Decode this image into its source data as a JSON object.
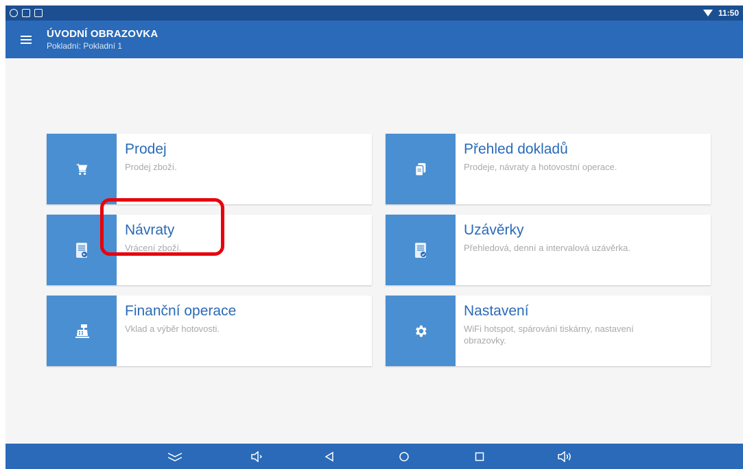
{
  "status_bar": {
    "time": "11:50",
    "left_icons": [
      "teamviewer-icon",
      "screen-icon",
      "sim-icon"
    ],
    "wifi_icon": "wifi-icon"
  },
  "app_bar": {
    "menu_icon": "hamburger-menu-icon",
    "title": "ÚVODNÍ OBRAZOVKA",
    "subtitle": "Pokladní: Pokladní 1"
  },
  "tiles": [
    {
      "title": "Prodej",
      "description": "Prodej zboží.",
      "icon": "cart-icon"
    },
    {
      "title": "Přehled dokladů",
      "description": "Prodeje, návraty a hotovostní operace.",
      "icon": "documents-icon"
    },
    {
      "title": "Návraty",
      "description": "Vrácení zboží.",
      "icon": "receipt-return-icon"
    },
    {
      "title": "Uzávěrky",
      "description": "Přehledová, denní a intervalová uzávěrka.",
      "icon": "receipt-check-icon"
    },
    {
      "title": "Finanční operace",
      "description": "Vklad a výběr hotovosti.",
      "icon": "cash-register-icon"
    },
    {
      "title": "Nastavení",
      "description": "WiFi hotspot, spárování tiskárny, nastavení obrazovky.",
      "icon": "gear-icon"
    }
  ],
  "nav_bar": {
    "buttons": [
      "collapse-icon",
      "volume-down-icon",
      "back-icon",
      "home-icon",
      "recents-icon",
      "volume-up-icon"
    ]
  },
  "colors": {
    "status_bar": "#1c4f92",
    "app_bar": "#2a6ab8",
    "tile_icon_bg": "#4a8fd1",
    "tile_title": "#2a6ab8",
    "highlight": "#e8000b"
  }
}
